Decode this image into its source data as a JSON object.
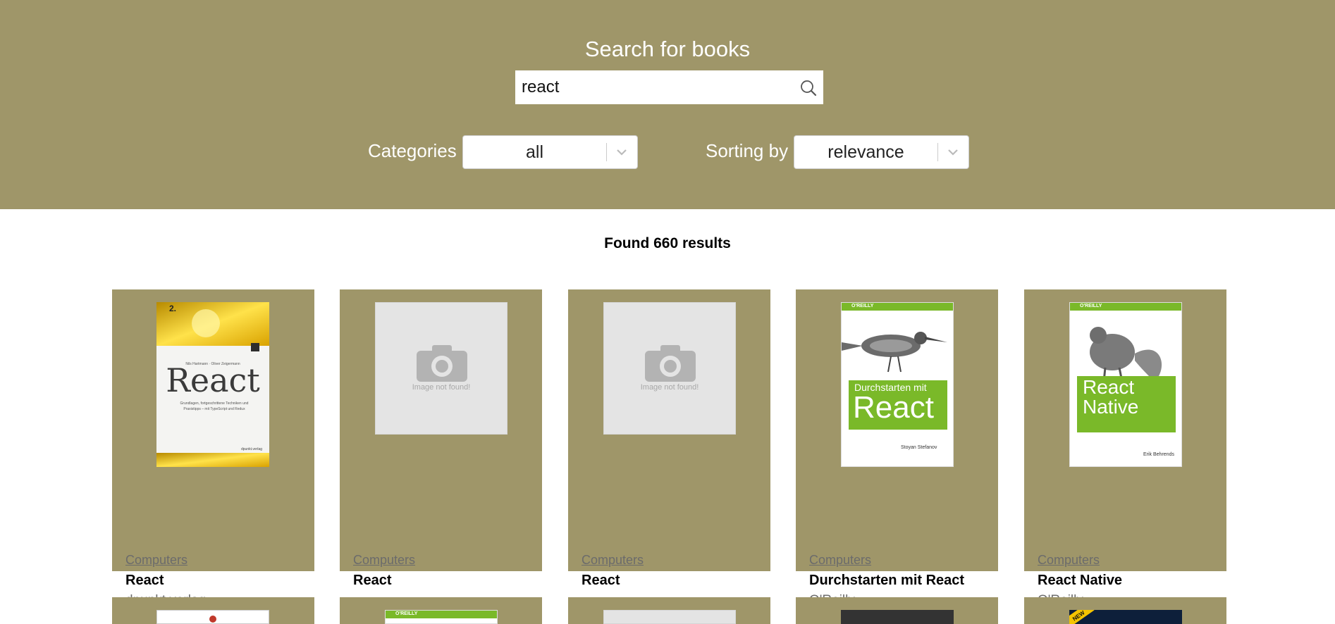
{
  "header": {
    "title": "Search for books",
    "search": {
      "value": "react",
      "placeholder": ""
    },
    "categories_label": "Categories",
    "categories_value": "all",
    "sorting_label": "Sorting by",
    "sorting_value": "relevance"
  },
  "results_text": "Found 660 results",
  "colors": {
    "header_bg": "#9f9669",
    "card_bg": "#9f9669"
  },
  "books": [
    {
      "category": "Computers",
      "title": "React",
      "publisher": "dpunkt.verlag",
      "cover": {
        "type": "image",
        "brand": "2.",
        "cover_title": "React",
        "authors": "Nils Hartmann · Oliver Zeigermann",
        "subtitle": "Grundlagen, fortgeschrittene Techniken und Praxistipps – mit TypeScript und Redux",
        "publisher_mark": "dpunkt.verlag"
      }
    },
    {
      "category": "Computers",
      "title": "React",
      "publisher": "",
      "cover": {
        "type": "placeholder",
        "text": "Image not found!"
      }
    },
    {
      "category": "Computers",
      "title": "React",
      "publisher": "",
      "cover": {
        "type": "placeholder",
        "text": "Image not found!"
      }
    },
    {
      "category": "Computers",
      "title": "Durchstarten mit React",
      "publisher": "O'Reilly",
      "cover": {
        "type": "image",
        "brand": "O'REILLY",
        "cover_title_1": "Durchstarten mit",
        "cover_title_2": "React",
        "author": "Stoyan Stefanov"
      }
    },
    {
      "category": "Computers",
      "title": "React Native",
      "publisher": "O'Reilly",
      "cover": {
        "type": "image",
        "brand": "O'REILLY",
        "cover_title_1": "React",
        "cover_title_2": "Native",
        "author": "Erik Behrends"
      }
    }
  ],
  "second_row_brand": "O'REILLY",
  "second_row_badge": "NEW"
}
